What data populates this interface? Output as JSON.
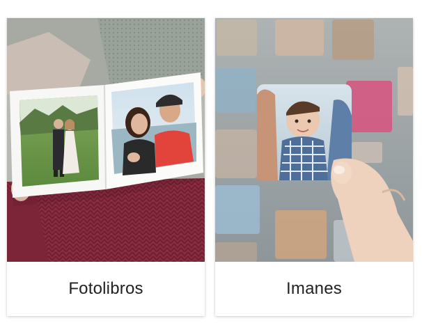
{
  "products": [
    {
      "label": "Fotolibros",
      "image": "photobook-open-on-lap-photo"
    },
    {
      "label": "Imanes",
      "image": "photo-magnet-held-in-hand-photo"
    }
  ],
  "colors": {
    "card_background": "#ffffff",
    "label_text": "#222222",
    "sweater": "#8a2a3e",
    "wall": "#8f9aa0"
  }
}
